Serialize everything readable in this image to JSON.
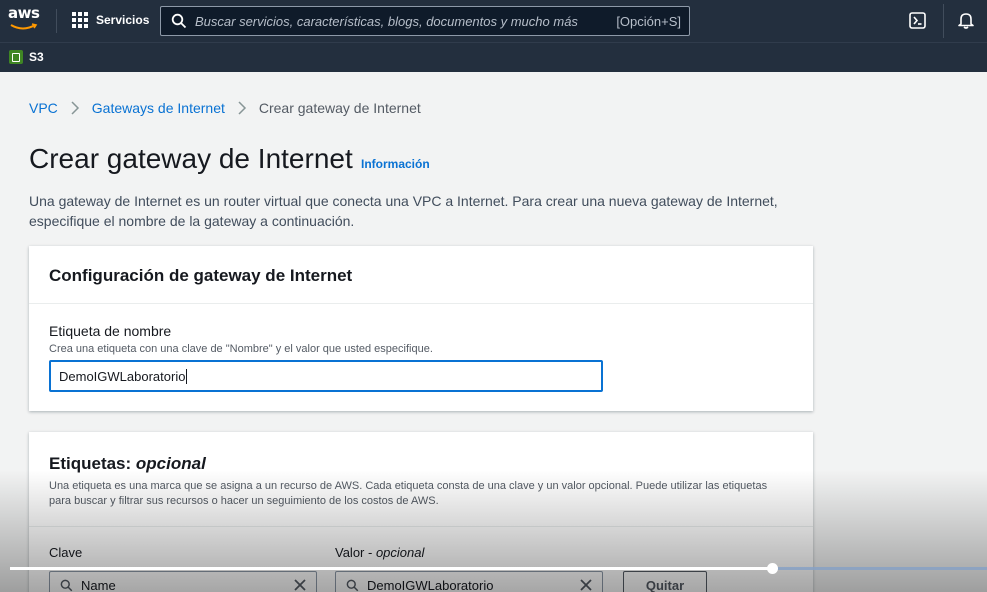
{
  "topnav": {
    "logo_text": "aws",
    "services_label": "Servicios",
    "search_placeholder": "Buscar servicios, características, blogs, documentos y mucho más",
    "search_shortcut": "[Opción+S]"
  },
  "favorites": [
    {
      "label": "S3"
    }
  ],
  "breadcrumb": {
    "items": [
      "VPC",
      "Gateways de Internet"
    ],
    "current": "Crear gateway de Internet"
  },
  "page": {
    "title": "Crear gateway de Internet",
    "info_link": "Información",
    "description": "Una gateway de Internet es un router virtual que conecta una VPC a Internet. Para crear una nueva gateway de Internet, especifique el nombre de la gateway a continuación."
  },
  "config_panel": {
    "title": "Configuración de gateway de Internet",
    "name_label": "Etiqueta de nombre",
    "name_hint": "Crea una etiqueta con una clave de \"Nombre\" y el valor que usted especifique.",
    "name_value": "DemoIGWLaboratorio"
  },
  "tags_panel": {
    "title_prefix": "Etiquetas: ",
    "title_optional": "opcional",
    "description": "Una etiqueta es una marca que se asigna a un recurso de AWS. Cada etiqueta consta de una clave y un valor opcional. Puede utilizar las etiquetas para buscar y filtrar sus recursos o hacer un seguimiento de los costos de AWS.",
    "key_header": "Clave",
    "value_header": "Valor - ",
    "value_header_optional": "opcional",
    "rows": [
      {
        "key": "Name",
        "value": "DemoIGWLaboratorio",
        "remove_label": "Quitar"
      }
    ]
  },
  "video": {
    "progress": 0.78
  },
  "colors": {
    "nav_bg": "#232f3e",
    "link": "#0972d3",
    "accent_orange": "#ff9900",
    "s3_green": "#3f8624"
  }
}
